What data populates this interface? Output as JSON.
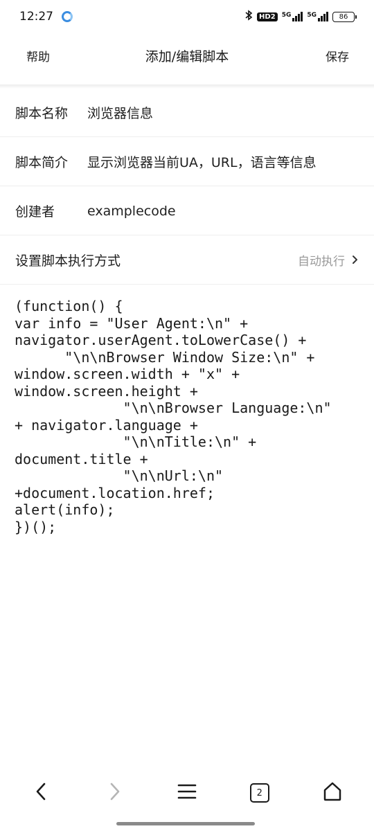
{
  "status_bar": {
    "time": "12:27",
    "hd_badge": "HD2",
    "net1_label": "5G",
    "net2_label": "5G",
    "battery_level": "86"
  },
  "header": {
    "help_label": "帮助",
    "title": "添加/编辑脚本",
    "save_label": "保存"
  },
  "form": {
    "name": {
      "label": "脚本名称",
      "value": "浏览器信息"
    },
    "description": {
      "label": "脚本简介",
      "value": "显示浏览器当前UA，URL，语言等信息"
    },
    "author": {
      "label": "创建者",
      "value": "examplecode"
    },
    "execution": {
      "label": "设置脚本执行方式",
      "value": "自动执行"
    }
  },
  "code": "(function() {\nvar info = \"User Agent:\\n\" +\nnavigator.userAgent.toLowerCase() +\n      \"\\n\\nBrowser Window Size:\\n\" +\nwindow.screen.width + \"x\" +\nwindow.screen.height +\n             \"\\n\\nBrowser Language:\\n\"\n+ navigator.language +\n             \"\\n\\nTitle:\\n\" +\ndocument.title +\n             \"\\n\\nUrl:\\n\"\n+document.location.href;\nalert(info);\n})();",
  "bottom_nav": {
    "tab_count": "2"
  },
  "icons": {
    "back": "chevron-left-icon",
    "forward": "chevron-right-icon",
    "menu": "hamburger-menu-icon",
    "tabs": "tabs-icon",
    "home": "home-icon"
  }
}
